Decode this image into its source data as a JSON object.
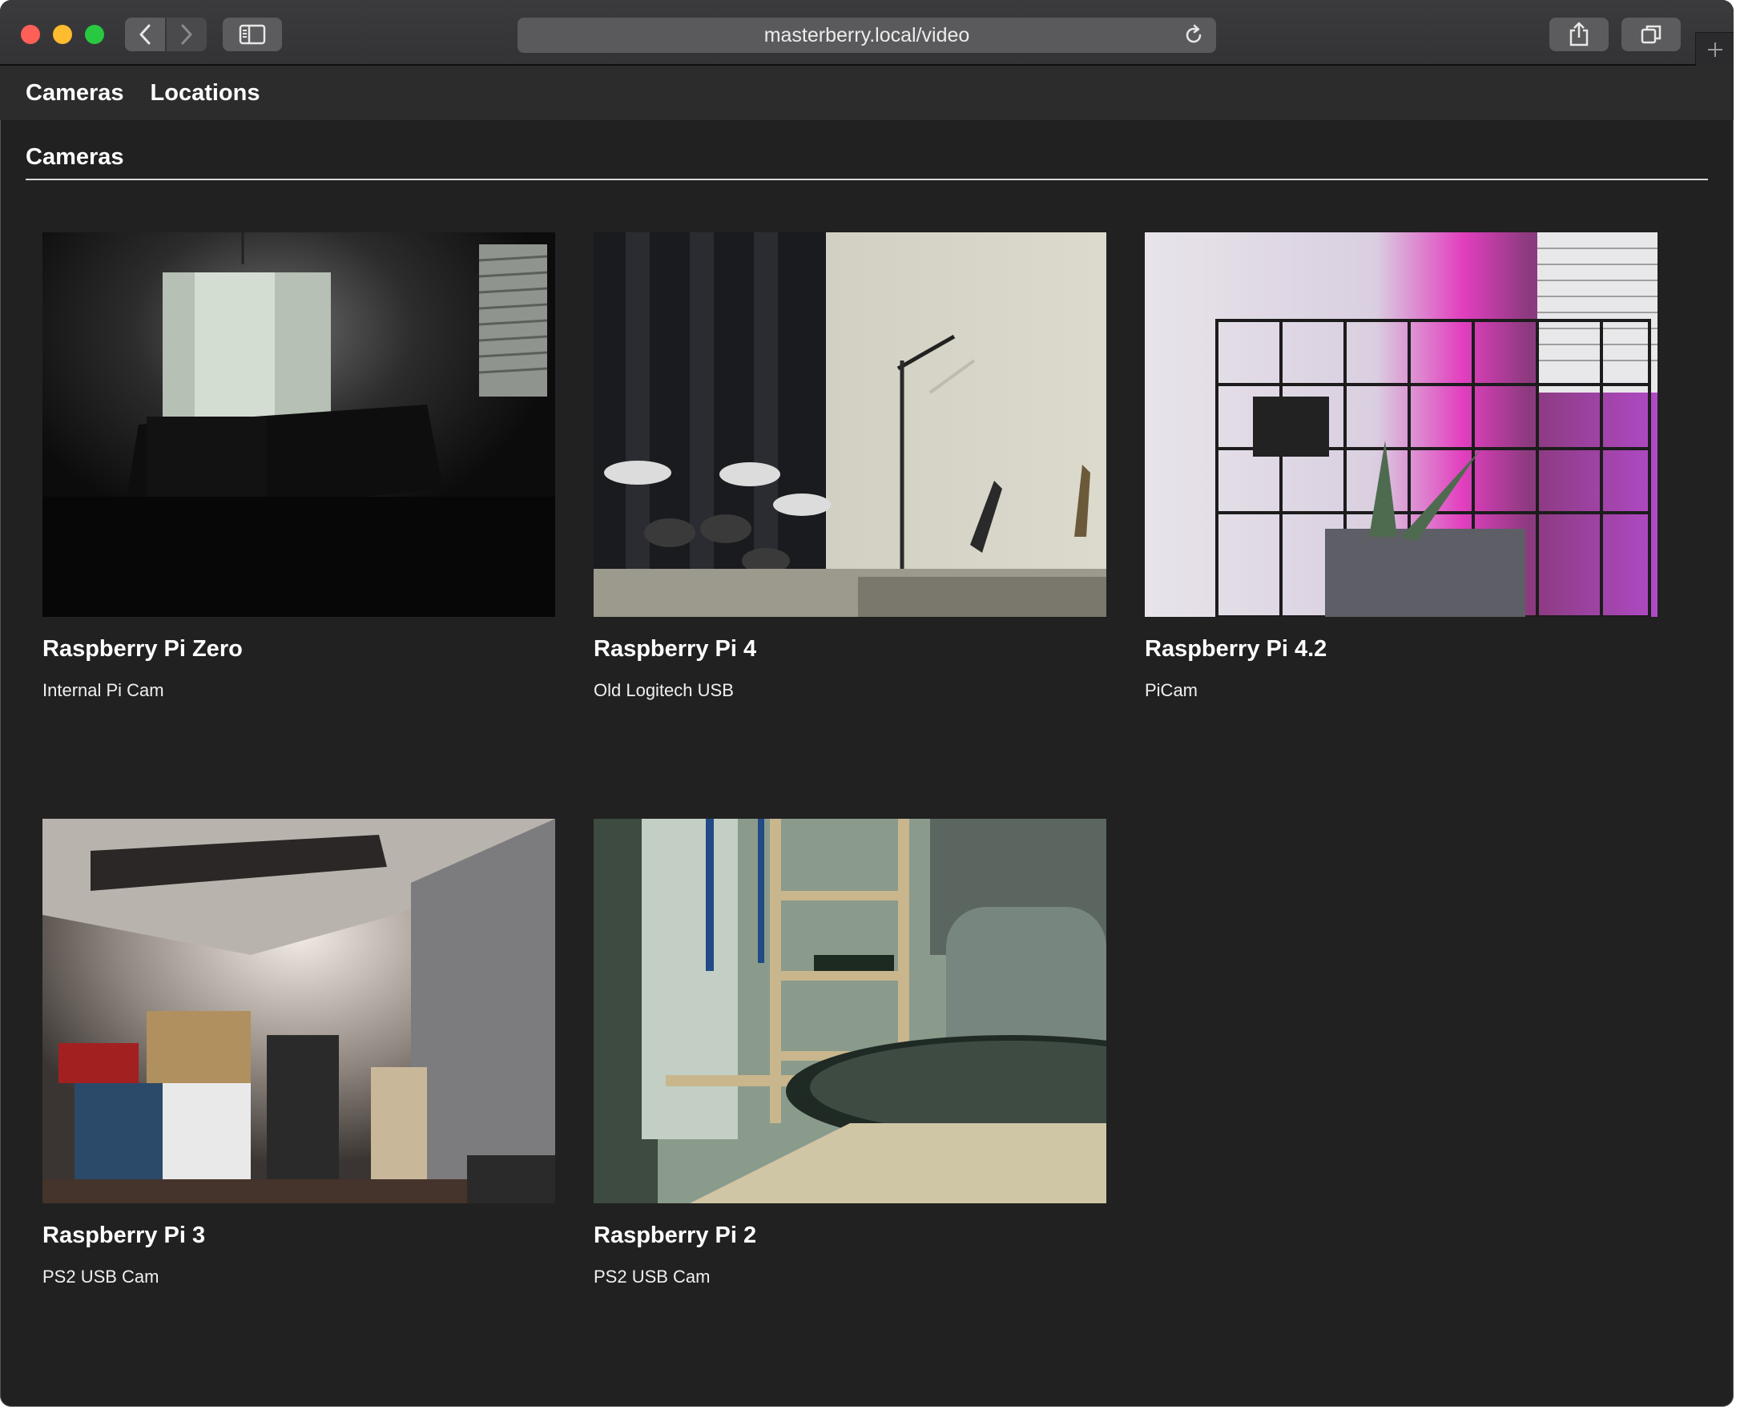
{
  "browser": {
    "url": "masterberry.local/video"
  },
  "nav": {
    "items": [
      "Cameras",
      "Locations"
    ]
  },
  "page": {
    "heading": "Cameras"
  },
  "cameras": [
    {
      "name": "Raspberry Pi Zero",
      "description": "Internal Pi Cam",
      "scene": "dim dining room with window"
    },
    {
      "name": "Raspberry Pi 4",
      "description": "Old Logitech USB",
      "scene": "electronic drum kit and mic stand"
    },
    {
      "name": "Raspberry Pi 4.2",
      "description": "PiCam",
      "scene": "grow light plant behind wire panel"
    },
    {
      "name": "Raspberry Pi 3",
      "description": "PS2 USB Cam",
      "scene": "basement storage with boxes"
    },
    {
      "name": "Raspberry Pi 2",
      "description": "PS2 USB Cam",
      "scene": "shelving and compressor, green tint"
    }
  ]
}
